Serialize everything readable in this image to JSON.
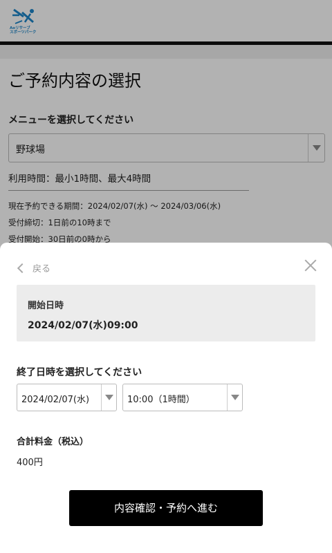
{
  "header": {
    "logo_text": "Aoリサーブ\nスポーツパーク"
  },
  "background": {
    "page_title": "ご予約内容の選択",
    "menu_label": "メニューを選択してください",
    "menu_selected": "野球場",
    "usage_time": "利用時間：最小1時間、最大4時間",
    "period": "現在予約できる期間：2024/02/07(水) 〜 2024/03/06(水)",
    "deadline": "受付締切：1日前の10時まで",
    "open": "受付開始：30日前の0時から"
  },
  "sheet": {
    "back_label": "戻る",
    "start_label": "開始日時",
    "start_value": "2024/02/07(水)09:00",
    "end_label": "終了日時を選択してください",
    "end_date_selected": "2024/02/07(水)",
    "end_time_selected": "10:00（1時間）",
    "fee_label": "合計料金（税込）",
    "fee_value": "400円",
    "proceed_label": "内容確認・予約へ進む"
  },
  "colors": {
    "logo_blue": "#1d86c9",
    "button_black": "#000000",
    "overlay": "rgba(0,0,0,0.30)"
  },
  "icons": [
    "logo-icon",
    "chevron-left-icon",
    "close-icon",
    "dropdown-arrow-icon"
  ]
}
